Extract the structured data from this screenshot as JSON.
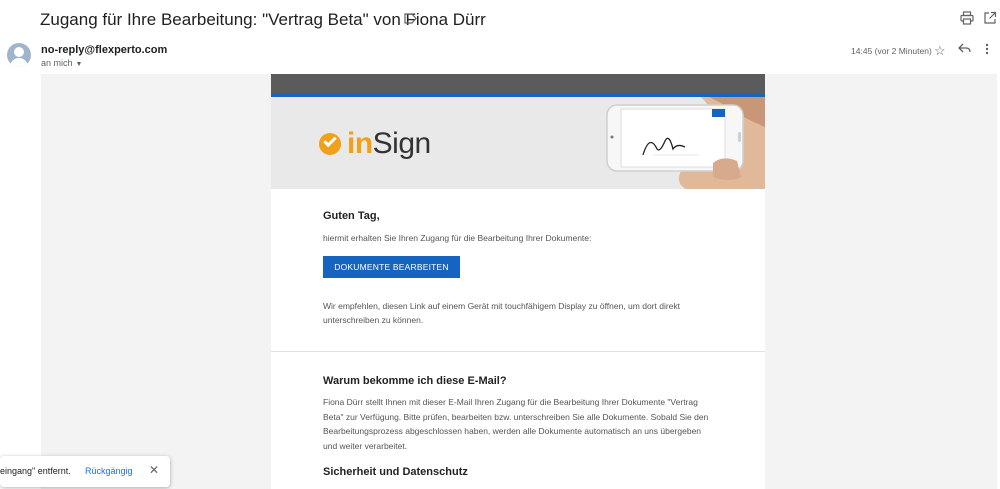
{
  "header": {
    "subject": "Zugang für Ihre Bearbeitung: \"Vertrag Beta\" von Fiona Dürr",
    "label_icon": "label-icon",
    "print_icon": "print-icon",
    "popout_icon": "open-in-new-window-icon"
  },
  "message": {
    "sender": "no-reply@flexperto.com",
    "recipient": "an mich",
    "time": "14:45 (vor 2 Minuten)",
    "icons": [
      "star-icon",
      "reply-icon",
      "more-icon"
    ]
  },
  "email": {
    "logo": {
      "in": "in",
      "sign": "Sign"
    },
    "greeting": "Guten Tag,",
    "intro": "hiermit erhalten Sie Ihren Zugang für die Bearbeitung Ihrer Dokumente:",
    "cta_label": "DOKUMENTE BEARBEITEN",
    "recommendation": "Wir empfehlen, diesen Link auf einem Gerät mit touchfähigem Display zu öffnen, um dort direkt unterschreiben zu können.",
    "why_title": "Warum bekomme ich diese E-Mail?",
    "why_text": "Fiona Dürr stellt Ihnen mit dieser E-Mail Ihren Zugang für die Bearbeitung Ihrer Dokumente \"Vertrag Beta\" zur Verfügung. Bitte prüfen, bearbeiten bzw. unterschreiben Sie alle Dokumente. Sobald Sie den Bearbeitungsprozess abgeschlossen haben, werden alle Dokumente automatisch an uns übergeben und weiter verarbeitet.",
    "security_title": "Sicherheit und Datenschutz",
    "colors": {
      "brand_orange": "#f0a019",
      "brand_blue": "#1565c0"
    }
  },
  "snackbar": {
    "text": "eingang\" entfernt.",
    "undo_label": "Rückgängig",
    "close_icon": "close-icon"
  }
}
